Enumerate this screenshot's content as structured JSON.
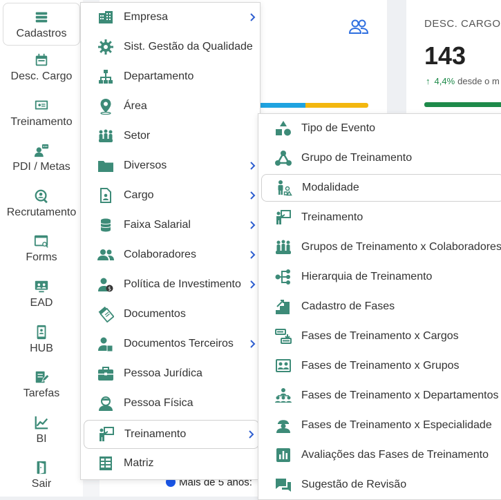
{
  "accent_color": "#3d8b78",
  "left_nav": [
    {
      "label": "Cadastros",
      "icon": "list-icon",
      "active": true
    },
    {
      "label": "Desc. Cargo",
      "icon": "calendar-icon"
    },
    {
      "label": "Treinamento",
      "icon": "presentation-icon"
    },
    {
      "label": "PDI / Metas",
      "icon": "chat-person-icon"
    },
    {
      "label": "Recrutamento",
      "icon": "magnifier-person-icon"
    },
    {
      "label": "Forms",
      "icon": "form-icon"
    },
    {
      "label": "EAD",
      "icon": "monitor-users-icon"
    },
    {
      "label": "HUB",
      "icon": "phone-icon"
    },
    {
      "label": "Tarefas",
      "icon": "edit-icon"
    },
    {
      "label": "BI",
      "icon": "chart-icon"
    },
    {
      "label": "Sair",
      "icon": "exit-icon"
    }
  ],
  "dashboard": {
    "card2_label": "DESC. CARGO",
    "card2_value": "143",
    "card2_trend_pct": "4,4%",
    "card2_trend_text": "desde o m",
    "legend_item": "Mais de 5 anos:"
  },
  "menu": {
    "items": [
      {
        "label": "Empresa",
        "icon": "building-icon",
        "submenu": true
      },
      {
        "label": "Sist. Gestão da Qualidade",
        "icon": "gear-icon",
        "submenu": false
      },
      {
        "label": "Departamento",
        "icon": "org-chart-icon",
        "submenu": false
      },
      {
        "label": "Área",
        "icon": "map-pin-icon",
        "submenu": false
      },
      {
        "label": "Setor",
        "icon": "group-icon",
        "submenu": false
      },
      {
        "label": "Diversos",
        "icon": "folder-icon",
        "submenu": true
      },
      {
        "label": "Cargo",
        "icon": "document-person-icon",
        "submenu": true
      },
      {
        "label": "Faixa Salarial",
        "icon": "coins-icon",
        "submenu": true
      },
      {
        "label": "Colaboradores",
        "icon": "users-icon",
        "submenu": true
      },
      {
        "label": "Política de Investimento",
        "icon": "person-money-icon",
        "submenu": true
      },
      {
        "label": "Documentos",
        "icon": "documents-icon",
        "submenu": false
      },
      {
        "label": "Documentos Terceiros",
        "icon": "person-document-icon",
        "submenu": true
      },
      {
        "label": "Pessoa Jurídica",
        "icon": "briefcase-icon",
        "submenu": false
      },
      {
        "label": "Pessoa Física",
        "icon": "person-icon",
        "submenu": false
      },
      {
        "label": "Treinamento",
        "icon": "presenter-icon",
        "submenu": true,
        "active": true
      },
      {
        "label": "Matriz",
        "icon": "matrix-icon",
        "submenu": false
      }
    ]
  },
  "submenu": {
    "items": [
      {
        "label": "Tipo de Evento",
        "icon": "shapes-icon"
      },
      {
        "label": "Grupo de Treinamento",
        "icon": "network-icon"
      },
      {
        "label": "Modalidade",
        "icon": "person-shapes-icon",
        "active": true
      },
      {
        "label": "Treinamento",
        "icon": "presenter-icon"
      },
      {
        "label": "Grupos de Treinamento x Colaboradores",
        "icon": "crowd-icon"
      },
      {
        "label": "Hierarquia de Treinamento",
        "icon": "hierarchy-icon"
      },
      {
        "label": "Cadastro de Fases",
        "icon": "stairs-icon"
      },
      {
        "label": "Fases de Treinamento x Cargos",
        "icon": "phases-cargo-icon"
      },
      {
        "label": "Fases de Treinamento x Grupos",
        "icon": "phases-group-icon"
      },
      {
        "label": "Fases de Treinamento x Departamentos",
        "icon": "phases-dept-icon"
      },
      {
        "label": "Fases de Treinamento x Especialidade",
        "icon": "phases-specialty-icon"
      },
      {
        "label": "Avaliações das Fases de Treinamento",
        "icon": "bar-chart-icon"
      },
      {
        "label": "Sugestão de Revisão",
        "icon": "comments-icon"
      }
    ]
  }
}
